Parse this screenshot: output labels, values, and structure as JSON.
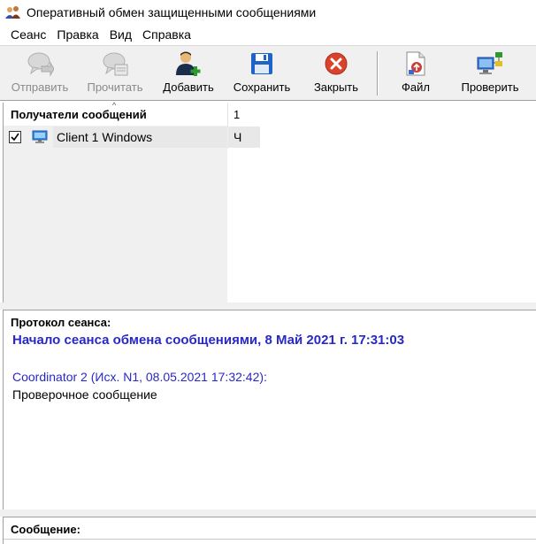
{
  "window": {
    "title": "Оперативный обмен защищенными сообщениями",
    "icon": "users-icon"
  },
  "menu": [
    "Сеанс",
    "Правка",
    "Вид",
    "Справка"
  ],
  "toolbar": {
    "send": {
      "label": "Отправить",
      "icon": "send-message-icon",
      "enabled": false
    },
    "read": {
      "label": "Прочитать",
      "icon": "read-message-icon",
      "enabled": false
    },
    "add": {
      "label": "Добавить",
      "icon": "add-user-icon",
      "enabled": true
    },
    "save": {
      "label": "Сохранить",
      "icon": "floppy-disk-icon",
      "enabled": true
    },
    "close": {
      "label": "Закрыть",
      "icon": "close-circle-icon",
      "enabled": true
    },
    "file": {
      "label": "Файл",
      "icon": "file-icon",
      "enabled": true
    },
    "check": {
      "label": "Проверить",
      "icon": "network-check-icon",
      "enabled": true
    }
  },
  "recipients": {
    "header": {
      "name": "Получатели сообщений",
      "count": "1"
    },
    "rows": [
      {
        "checked": true,
        "name": "Client 1 Windows",
        "status": "Ч"
      }
    ]
  },
  "protocol": {
    "label": "Протокол сеанса:",
    "session_start": "Начало сеанса обмена сообщениями, 8 Май 2021 г. 17:31:03",
    "messages": [
      {
        "header": "Coordinator 2 (Исх. N1, 08.05.2021 17:32:42):",
        "body": "Проверочное сообщение"
      }
    ]
  },
  "message": {
    "label": "Сообщение:"
  },
  "colors": {
    "accent_blue": "#2828c8",
    "toolbar_bg": "#f0f0f0",
    "disabled_text": "#8a8a8a",
    "close_red": "#d9432b"
  }
}
